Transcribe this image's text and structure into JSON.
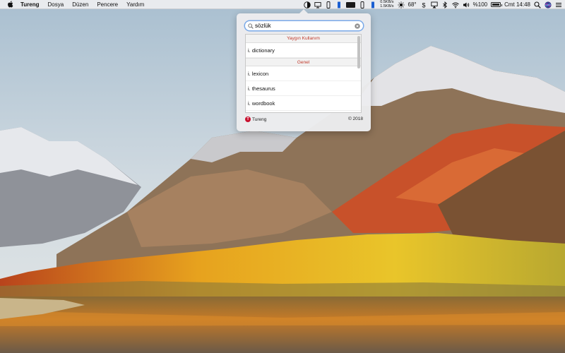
{
  "menubar": {
    "items": [
      "Tureng",
      "Dosya",
      "Düzen",
      "Pencere",
      "Yardım"
    ],
    "network": {
      "upload": "0.5KB/s",
      "download": "1.5KB/s"
    },
    "temperature": "68°",
    "battery_percent": "%100",
    "battery_level": 1.0,
    "clock": "Cmt 14:48"
  },
  "popover": {
    "search_value": "sözlük",
    "sections": [
      {
        "header": "Yaygın Kullanım",
        "results": [
          "i. dictionary"
        ]
      },
      {
        "header": "Genel",
        "results": [
          "i. lexicon",
          "i. thesaurus",
          "i. wordbook"
        ]
      }
    ],
    "footer": {
      "brand": "Tureng",
      "logo_letter": "T",
      "copyright": "© 2018"
    }
  },
  "colors": {
    "accent": "#c0392b",
    "search_focus": "#7aa9e8",
    "brand_red": "#c8102e"
  }
}
